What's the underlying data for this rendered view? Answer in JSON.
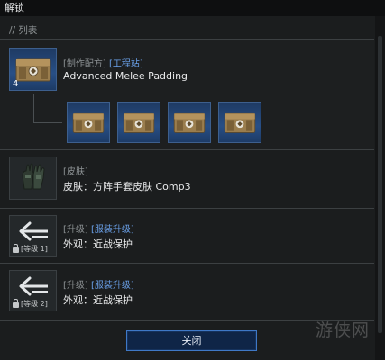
{
  "window": {
    "title": "解锁"
  },
  "section": {
    "label": "// 列表"
  },
  "entries": [
    {
      "tag1": "[制作配方]",
      "tag2": "[工程站]",
      "name": "Advanced Melee Padding",
      "quantity": "4",
      "icon": "padding-crate-icon",
      "children_icons": [
        "padding-crate-icon",
        "padding-crate-icon",
        "padding-crate-icon",
        "padding-crate-icon"
      ]
    },
    {
      "tag1": "[皮肤]",
      "tag2": "",
      "name": "皮肤：方阵手套皮肤 Comp3",
      "icon": "gloves-icon"
    },
    {
      "tag1": "[升级]",
      "tag2": "[服装升级]",
      "name": "外观：近战保护",
      "level": "[等级 1]",
      "icon": "upgrade-arrow-icon"
    },
    {
      "tag1": "[升级]",
      "tag2": "[服装升级]",
      "name": "外观：近战保护",
      "level": "[等级 2]",
      "icon": "upgrade-arrow-icon"
    }
  ],
  "footer": {
    "close_label": "关闭"
  },
  "watermark": {
    "text": "游侠网"
  },
  "colors": {
    "accent": "#3f78c6",
    "tag_blue": "#6aa0e8",
    "background": "#1b1d1e"
  }
}
